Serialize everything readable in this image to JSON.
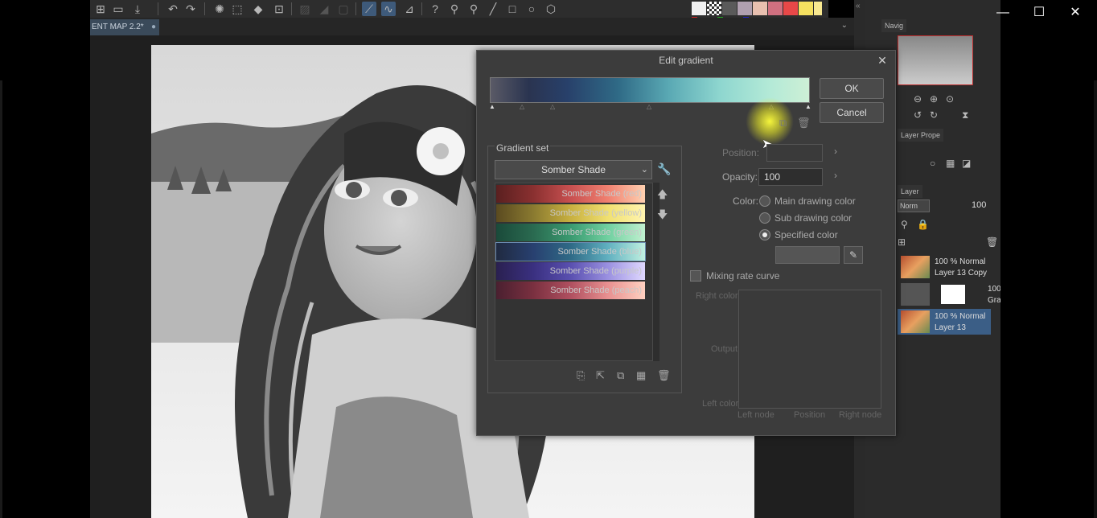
{
  "document": {
    "tab_title": "ENT MAP 2.2*",
    "modified_mark": "●"
  },
  "toolbar": {
    "icons": [
      "new-file-icon",
      "open-folder-icon",
      "save-icon",
      "separator",
      "undo-icon",
      "redo-icon",
      "separator",
      "loading-icon",
      "crop-icon",
      "fill-icon",
      "transform-icon",
      "separator",
      "grid-icon",
      "ruler-icon",
      "frame-icon",
      "separator",
      "pen-tool-icon",
      "curve-tool-icon",
      "ruler-tool-icon",
      "separator",
      "help-icon",
      "zoom-in-icon",
      "zoom-out-icon",
      "line-icon",
      "rect-icon",
      "circle-icon",
      "polygon-icon"
    ]
  },
  "palette": {
    "swatches": [
      "#f0f0f0",
      "checker",
      "#5a5a5a",
      "#b0a0b0",
      "#e8c0b0",
      "#d07080",
      "#e84848",
      "#f4e060",
      "#f8e890"
    ],
    "dots": [
      "#cc2222",
      "#22aa22",
      "#2222cc"
    ]
  },
  "dialog": {
    "title": "Edit gradient",
    "ok_label": "OK",
    "cancel_label": "Cancel",
    "gradient_set_label": "Gradient set",
    "selected_set": "Somber Shade",
    "gradients": [
      {
        "name": "Somber Shade (red)",
        "colors": [
          "#5a2020",
          "#8a3030",
          "#c85050",
          "#f08070",
          "#ffd0b0"
        ]
      },
      {
        "name": "Somber Shade (yellow)",
        "colors": [
          "#5a4a20",
          "#8a7a30",
          "#c8b040",
          "#f0e070",
          "#fff4b0"
        ]
      },
      {
        "name": "Somber Shade (green)",
        "colors": [
          "#1a4a3a",
          "#2a6a50",
          "#3a9a70",
          "#70d0a0",
          "#c0f0d0"
        ]
      },
      {
        "name": "Somber Shade (blue)",
        "colors": [
          "#202a40",
          "#284070",
          "#2f6a86",
          "#60b0c0",
          "#c0f0e0"
        ]
      },
      {
        "name": "Somber Shade (purple)",
        "colors": [
          "#2a2050",
          "#3a3080",
          "#5a50b0",
          "#9a90e0",
          "#e0d8ff"
        ]
      },
      {
        "name": "Somber Shade (peach)",
        "colors": [
          "#4a2030",
          "#7a3040",
          "#b05060",
          "#e89090",
          "#ffd0c0"
        ]
      }
    ],
    "position_label": "Position:",
    "position_value": "",
    "opacity_label": "Opacity:",
    "opacity_value": "100",
    "color_label": "Color:",
    "color_options": [
      "Main drawing color",
      "Sub drawing color",
      "Specified color"
    ],
    "selected_color_option": "Specified color",
    "mixing_label": "Mixing rate curve",
    "right_color_label": "Right color",
    "output_label": "Output",
    "left_color_label": "Left color",
    "left_node_label": "Left node",
    "position_axis_label": "Position",
    "right_node_label": "Right node"
  },
  "right_panel": {
    "navigator_tab": "Navig",
    "layer_property_tab": "Layer Prope",
    "layer_tab": "Layer",
    "blend_mode": "Norm",
    "opacity": "100",
    "layers": [
      {
        "line1": "100 % Normal",
        "line2": "Layer 13 Copy",
        "selected": false
      },
      {
        "line1": "100",
        "line2": "Gra",
        "selected": false
      },
      {
        "line1": "100 % Normal",
        "line2": "Layer 13",
        "selected": true
      }
    ]
  },
  "window_controls": {
    "minimize": "—",
    "maximize": "☐",
    "close": "✕"
  }
}
